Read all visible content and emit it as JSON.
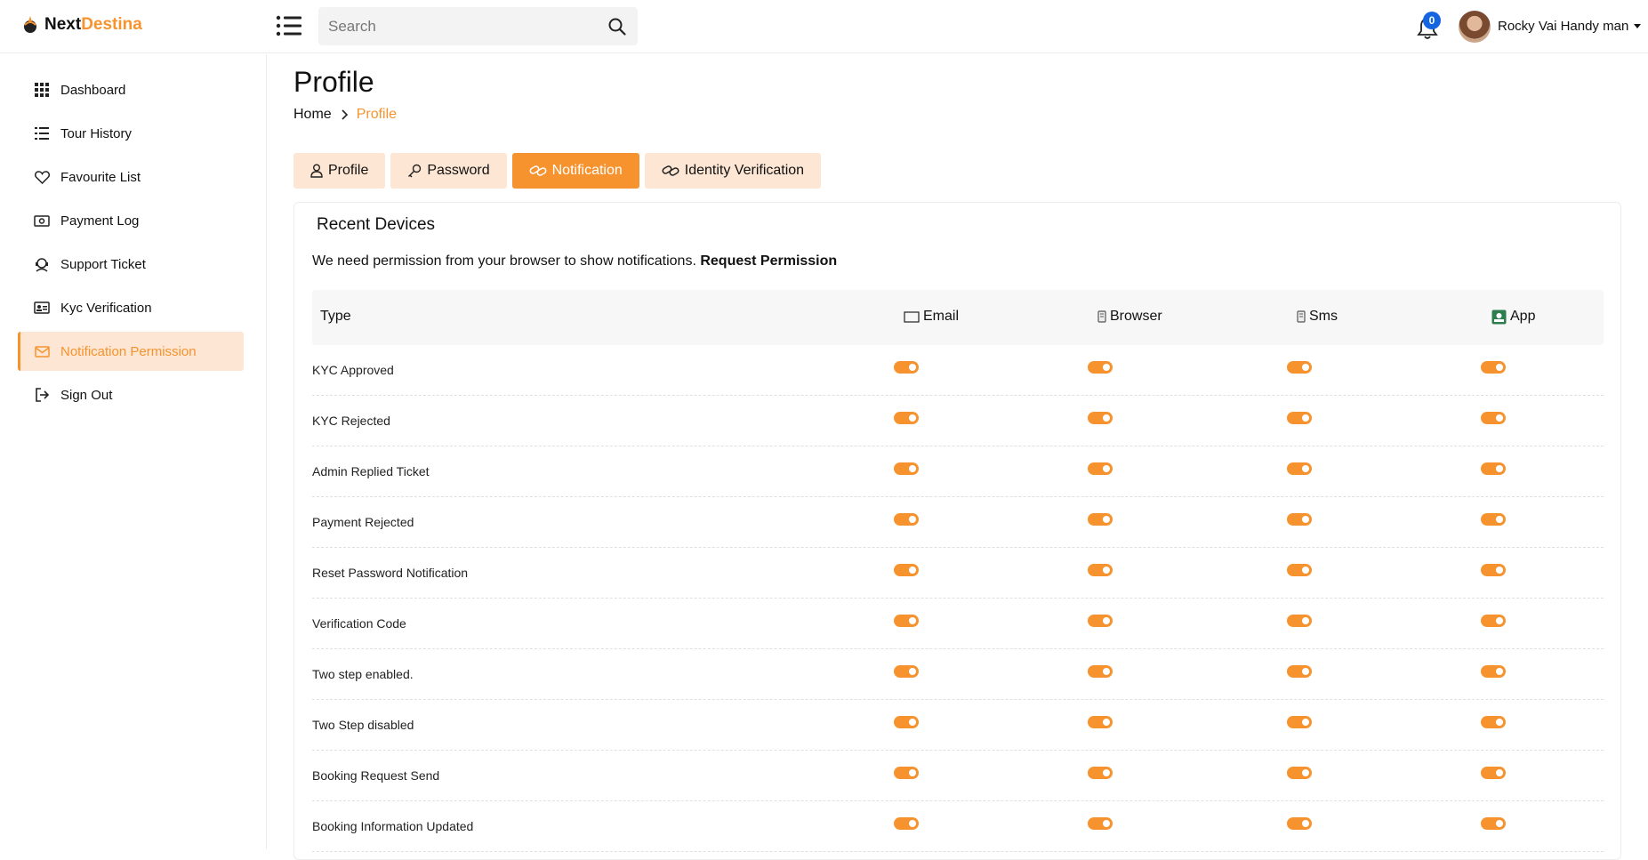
{
  "brand": {
    "name_part1": "Next",
    "name_part2": "Destina",
    "accent": "#f7932e"
  },
  "search": {
    "placeholder": "Search"
  },
  "notifications": {
    "count": "0"
  },
  "user": {
    "name": "Rocky Vai Handy man"
  },
  "sidebar": {
    "items": [
      {
        "label": "Dashboard",
        "icon": "grid-icon"
      },
      {
        "label": "Tour History",
        "icon": "list-icon"
      },
      {
        "label": "Favourite List",
        "icon": "heart-icon"
      },
      {
        "label": "Payment Log",
        "icon": "money-icon"
      },
      {
        "label": "Support Ticket",
        "icon": "headset-icon"
      },
      {
        "label": "Kyc Verification",
        "icon": "id-card-icon"
      },
      {
        "label": "Notification Permission",
        "icon": "envelope-icon",
        "active": true
      },
      {
        "label": "Sign Out",
        "icon": "sign-out-icon"
      }
    ]
  },
  "page": {
    "title": "Profile",
    "breadcrumb": {
      "home": "Home",
      "current": "Profile"
    }
  },
  "tabs": [
    {
      "label": "Profile",
      "icon": "user-icon"
    },
    {
      "label": "Password",
      "icon": "key-icon"
    },
    {
      "label": "Notification",
      "icon": "link-icon",
      "active": true
    },
    {
      "label": "Identity Verification",
      "icon": "link-icon"
    }
  ],
  "card": {
    "title": "Recent Devices",
    "permission_text": "We need permission from your browser to show notifications.",
    "permission_link": "Request Permission"
  },
  "table": {
    "headers": {
      "type": "Type",
      "email": "Email",
      "browser": "Browser",
      "sms": "Sms",
      "app": "App"
    },
    "rows": [
      {
        "label": "KYC Approved",
        "email": true,
        "browser": true,
        "sms": true,
        "app": true
      },
      {
        "label": "KYC Rejected",
        "email": true,
        "browser": true,
        "sms": true,
        "app": true
      },
      {
        "label": "Admin Replied Ticket",
        "email": true,
        "browser": true,
        "sms": true,
        "app": true
      },
      {
        "label": "Payment Rejected",
        "email": true,
        "browser": true,
        "sms": true,
        "app": true
      },
      {
        "label": "Reset Password Notification",
        "email": true,
        "browser": true,
        "sms": true,
        "app": true
      },
      {
        "label": "Verification Code",
        "email": true,
        "browser": true,
        "sms": true,
        "app": true
      },
      {
        "label": "Two step enabled.",
        "email": true,
        "browser": true,
        "sms": true,
        "app": true
      },
      {
        "label": "Two Step disabled",
        "email": true,
        "browser": true,
        "sms": true,
        "app": true
      },
      {
        "label": "Booking Request Send",
        "email": true,
        "browser": true,
        "sms": true,
        "app": true
      },
      {
        "label": "Booking Information Updated",
        "email": true,
        "browser": true,
        "sms": true,
        "app": true
      }
    ]
  }
}
